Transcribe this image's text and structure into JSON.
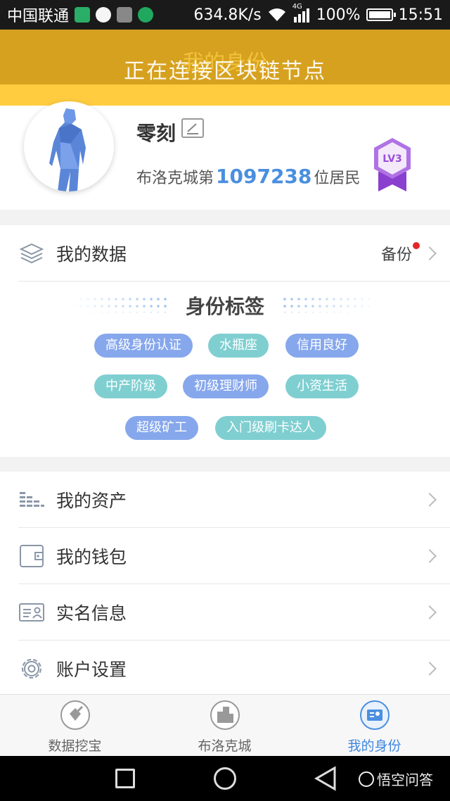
{
  "status_bar": {
    "carrier": "中国联通",
    "speed": "634.8K/s",
    "network": "4G",
    "battery": "100%",
    "time": "15:51"
  },
  "header": {
    "title": "我的身份",
    "toast": "正在连接区块链节点"
  },
  "profile": {
    "username": "零刻",
    "resident_prefix": "布洛克城第",
    "resident_number": "1097238",
    "resident_suffix": "位居民",
    "level": "LV3"
  },
  "my_data": {
    "label": "我的数据",
    "backup_label": "备份"
  },
  "identity_tags": {
    "title": "身份标签",
    "tags": [
      {
        "label": "高级身份认证",
        "color": "#86a7ec"
      },
      {
        "label": "水瓶座",
        "color": "#7fcfd1"
      },
      {
        "label": "信用良好",
        "color": "#86a7ec"
      },
      {
        "label": "中产阶级",
        "color": "#7fcfd1"
      },
      {
        "label": "初级理财师",
        "color": "#86a7ec"
      },
      {
        "label": "小资生活",
        "color": "#7fcfd1"
      },
      {
        "label": "超级矿工",
        "color": "#86a7ec"
      },
      {
        "label": "入门级刷卡达人",
        "color": "#7fcfd1"
      }
    ]
  },
  "menu": [
    {
      "label": "我的资产",
      "icon": "assets-bars-icon"
    },
    {
      "label": "我的钱包",
      "icon": "wallet-icon"
    },
    {
      "label": "实名信息",
      "icon": "id-card-icon"
    },
    {
      "label": "账户设置",
      "icon": "gear-icon"
    }
  ],
  "bottom_nav": [
    {
      "label": "数据挖宝",
      "icon": "shovel-icon",
      "active": false
    },
    {
      "label": "布洛克城",
      "icon": "city-icon",
      "active": false
    },
    {
      "label": "我的身份",
      "icon": "identity-card-icon",
      "active": true
    }
  ],
  "watermark": "悟空问答",
  "colors": {
    "header_gold": "#d6a11f",
    "header_yellow": "#ffcc3f",
    "accent_blue": "#4a8fe0",
    "tag_blue": "#86a7ec",
    "tag_teal": "#7fcfd1",
    "badge_purple": "#a45ad6"
  }
}
